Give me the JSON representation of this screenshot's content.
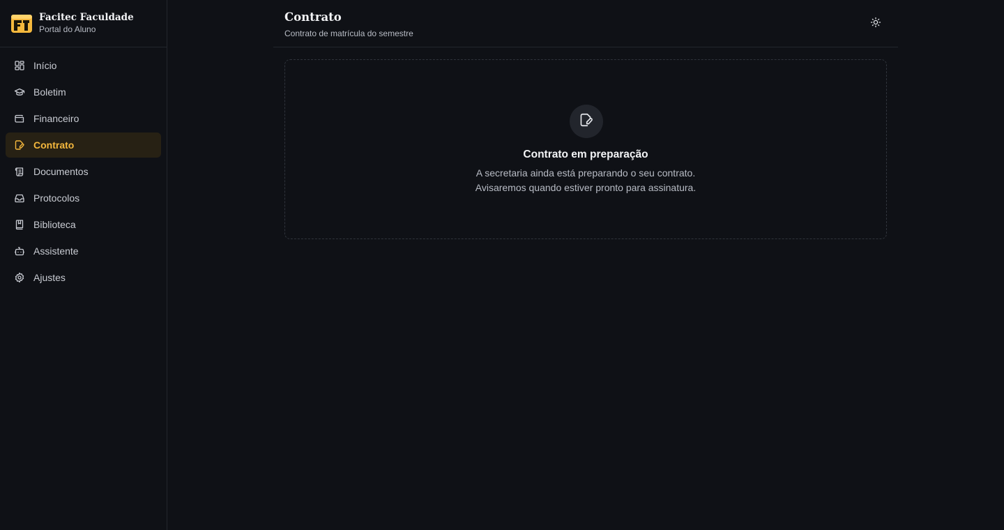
{
  "brand": {
    "name": "Facitec Faculdade",
    "subtitle": "Portal do Aluno"
  },
  "sidebar": {
    "items": [
      {
        "label": "Início",
        "icon": "grid-icon"
      },
      {
        "label": "Boletim",
        "icon": "graduation-cap-icon"
      },
      {
        "label": "Financeiro",
        "icon": "wallet-icon"
      },
      {
        "label": "Contrato",
        "icon": "file-pen-icon",
        "active": true
      },
      {
        "label": "Documentos",
        "icon": "scroll-icon"
      },
      {
        "label": "Protocolos",
        "icon": "inbox-icon"
      },
      {
        "label": "Biblioteca",
        "icon": "book-icon"
      },
      {
        "label": "Assistente",
        "icon": "bot-icon"
      },
      {
        "label": "Ajustes",
        "icon": "gear-icon"
      }
    ]
  },
  "header": {
    "title": "Contrato",
    "subtitle": "Contrato de matrícula do semestre",
    "theme_icon": "sun-icon"
  },
  "empty_state": {
    "icon": "file-pen-icon",
    "title": "Contrato em preparação",
    "line1": "A secretaria ainda está preparando o seu contrato.",
    "line2": "Avisaremos quando estiver pronto para assinatura."
  },
  "colors": {
    "accent": "#f5b83d",
    "active_bg": "#272114",
    "background": "#0f1116"
  }
}
